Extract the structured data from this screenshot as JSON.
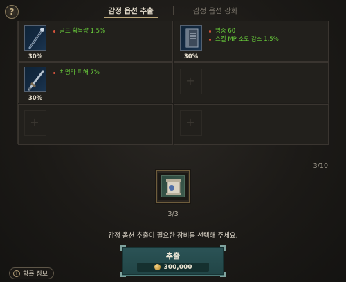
{
  "help": {
    "icon": "question-icon",
    "glyph": "?"
  },
  "tabs": [
    {
      "label": "감정 옵션 추출",
      "active": true
    },
    {
      "label": "감정 옵션 강화",
      "active": false
    }
  ],
  "slots": [
    {
      "icon": "staff-icon",
      "percent": "30%",
      "options": [
        "골드 획득량 1.5%"
      ]
    },
    {
      "icon": "book-icon",
      "percent": "30%",
      "options": [
        "명중 60",
        "스킬 MP 소모 감소 1.5%"
      ]
    },
    {
      "icon": "sword-icon",
      "percent": "30%",
      "options": [
        "치명타 피해 7%"
      ]
    },
    {
      "empty": true
    },
    {
      "empty": true
    },
    {
      "empty": true
    }
  ],
  "slot_count": "3/10",
  "center_item": {
    "icon": "scroll-icon",
    "count": "3/3"
  },
  "instruction": "감정 옵션 추출이 필요한 장비를 선택해 주세요.",
  "extract_button": {
    "label": "추출",
    "cost": "300,000",
    "cost_icon": "gold-coin-icon"
  },
  "probability_button": {
    "label": "확률 정보",
    "icon": "info-icon",
    "glyph": "i"
  },
  "colors": {
    "option_text": "#6bd23c",
    "option_bullet": "#d5533c",
    "button_bg": "#2b5356"
  }
}
